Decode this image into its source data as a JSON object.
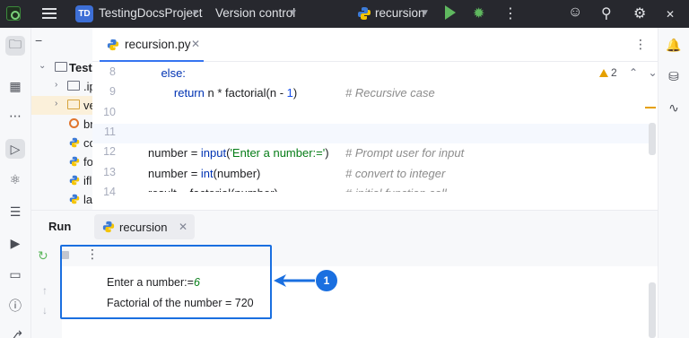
{
  "titlebar": {
    "project_badge": "TD",
    "project_name": "TestingDocsProject",
    "vcs_label": "Version control",
    "run_config": "recursion"
  },
  "project_panel": {
    "root_label": "Test",
    "rows": [
      {
        "label": ".ip",
        "type": "folder"
      },
      {
        "label": "ve",
        "type": "folder"
      },
      {
        "label": "br",
        "type": "file"
      },
      {
        "label": "co",
        "type": "py"
      },
      {
        "label": "fo",
        "type": "py"
      },
      {
        "label": "ifl",
        "type": "py"
      },
      {
        "label": "la",
        "type": "py"
      }
    ]
  },
  "editor": {
    "tab_label": "recursion.py",
    "warnings_count": "2",
    "lines": [
      {
        "num": "8",
        "indent": "    ",
        "parts": [
          {
            "t": "else:",
            "c": "kw"
          }
        ]
      },
      {
        "num": "9",
        "indent": "        ",
        "parts": [
          {
            "t": "return",
            "c": "kw"
          },
          {
            "t": " n * factorial(n - ",
            "c": ""
          },
          {
            "t": "1",
            "c": "num"
          },
          {
            "t": ")",
            "c": ""
          }
        ],
        "comment": "# Recursive case"
      },
      {
        "num": "10",
        "indent": "",
        "parts": []
      },
      {
        "num": "11",
        "indent": "",
        "parts": []
      },
      {
        "num": "12",
        "indent": "",
        "parts": [
          {
            "t": "number = ",
            "c": ""
          },
          {
            "t": "input",
            "c": "kw"
          },
          {
            "t": "(",
            "c": ""
          },
          {
            "t": "'Enter a number:='",
            "c": "str"
          },
          {
            "t": ")",
            "c": ""
          }
        ],
        "comment": "# Prompt user for input"
      },
      {
        "num": "13",
        "indent": "",
        "parts": [
          {
            "t": "number = ",
            "c": ""
          },
          {
            "t": "int",
            "c": "kw"
          },
          {
            "t": "(number)",
            "c": ""
          }
        ],
        "comment": "# convert to integer"
      },
      {
        "num": "14",
        "indent": "",
        "parts": [
          {
            "t": "result = factorial(number)",
            "c": ""
          }
        ],
        "comment": "# initial function call"
      }
    ]
  },
  "run_panel": {
    "title": "Run",
    "tab_label": "recursion",
    "output_prompt": "Enter a number:=",
    "output_input": "6",
    "output_result": "Factorial of the number = 720"
  },
  "annotation": {
    "badge": "1",
    "color": "#1a6fe0"
  }
}
